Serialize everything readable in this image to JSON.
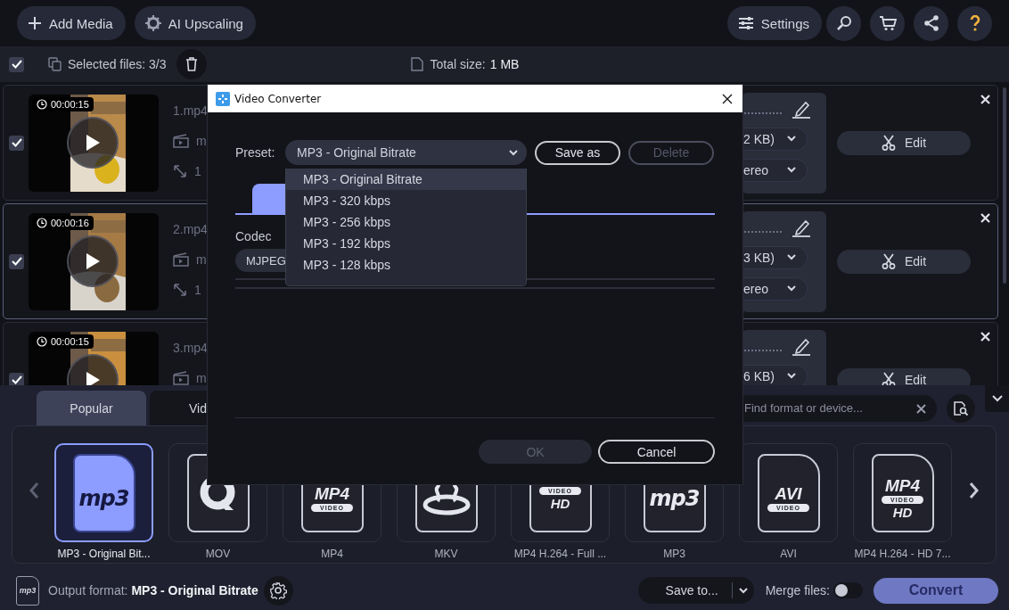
{
  "toolbar": {
    "add_media": "Add Media",
    "ai_upscaling": "AI Upscaling",
    "settings": "Settings"
  },
  "selection_bar": {
    "all_checked": true,
    "selected_files": "Selected files: 3/3",
    "total_size_label": "Total size:",
    "total_size": "1 MB"
  },
  "files": [
    {
      "checked": true,
      "selected": false,
      "duration": "00:00:15",
      "name": "1.mp4",
      "details": [
        "m",
        "1"
      ],
      "size": "2 KB)",
      "audio": "ereo",
      "edit": "Edit"
    },
    {
      "checked": true,
      "selected": true,
      "duration": "00:00:16",
      "name": "2.mp4",
      "details": [
        "m",
        "1"
      ],
      "size": "3 KB)",
      "audio": "ereo",
      "edit": "Edit"
    },
    {
      "checked": true,
      "selected": false,
      "duration": "00:00:15",
      "name": "3.mp4",
      "details": [
        "m"
      ],
      "size": "6 KB)",
      "edit": "Edit"
    }
  ],
  "format_panel": {
    "tabs": [
      {
        "label": "Popular",
        "selected": true
      },
      {
        "label": "Vid",
        "selected": false
      }
    ],
    "search": {
      "placeholder": "Find format or device..."
    },
    "formats": [
      {
        "label": "MP3 - Original Bit...",
        "kind": "file",
        "selected": true,
        "logo": [
          {
            "text": "mp3",
            "kind": "script"
          }
        ]
      },
      {
        "label": "MOV",
        "kind": "mov",
        "selected": false
      },
      {
        "label": "MP4",
        "kind": "file",
        "selected": false,
        "logo": [
          {
            "text": "MP4",
            "kind": "title"
          },
          {
            "text": "VIDEO",
            "kind": "band"
          }
        ]
      },
      {
        "label": "MKV",
        "kind": "mkv",
        "selected": false
      },
      {
        "label": "MP4 H.264 - Full ...",
        "kind": "file",
        "selected": false,
        "logo": [
          {
            "text": "VIDEO",
            "kind": "band"
          },
          {
            "text": "HD",
            "kind": "sub"
          }
        ]
      },
      {
        "label": "MP3",
        "kind": "file",
        "selected": false,
        "logo": [
          {
            "text": "mp3",
            "kind": "script"
          }
        ]
      },
      {
        "label": "AVI",
        "kind": "file",
        "selected": false,
        "logo": [
          {
            "text": "AVI",
            "kind": "title"
          },
          {
            "text": "VIDEO",
            "kind": "band"
          }
        ]
      },
      {
        "label": "MP4 H.264 - HD 7...",
        "kind": "file",
        "selected": false,
        "logo": [
          {
            "text": "MP4",
            "kind": "title"
          },
          {
            "text": "VIDEO",
            "kind": "band"
          },
          {
            "text": "HD",
            "kind": "sub"
          }
        ]
      }
    ]
  },
  "footer": {
    "output_logo": "mp3",
    "output_format": "Output format: **MP3 - Original Bitrate**",
    "save_to": "Save to...",
    "merge_label": "Merge files:",
    "merge_on": false,
    "convert": "Convert"
  },
  "dialog": {
    "title": "Video Converter",
    "preset_label": "Preset:",
    "preset_value": "MP3 - Original Bitrate",
    "save_as": {
      "label": "Save as",
      "disabled": false
    },
    "delete": {
      "label": "Delete",
      "disabled": true
    },
    "preset_options": [
      {
        "label": "MP3 - Original Bitrate",
        "selected": true
      },
      {
        "label": "MP3 - 320 kbps",
        "selected": false
      },
      {
        "label": "MP3 - 256 kbps",
        "selected": false
      },
      {
        "label": "MP3 - 192 kbps",
        "selected": false
      },
      {
        "label": "MP3 - 128 kbps",
        "selected": false
      }
    ],
    "codec_label": "Codec",
    "codec_value": "MJPEG",
    "ok": {
      "label": "OK",
      "disabled": true
    },
    "cancel": {
      "label": "Cancel",
      "disabled": false
    }
  }
}
